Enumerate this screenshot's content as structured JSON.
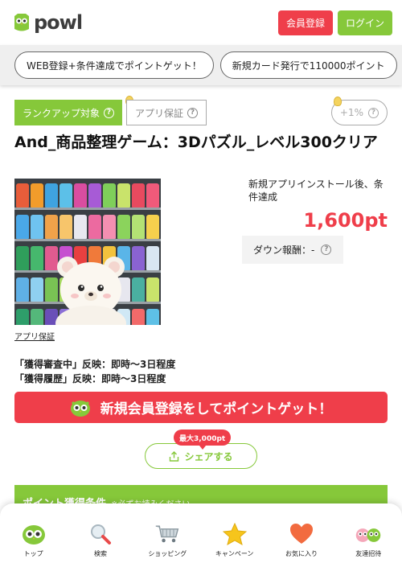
{
  "header": {
    "logo_text": "powl",
    "register_label": "会員登録",
    "login_label": "ログイン"
  },
  "banners": [
    {
      "label": "WEB登録+条件達成でポイントゲット！"
    },
    {
      "label": "新規カード発行で110000ポイント"
    }
  ],
  "tags": {
    "rank_up": "ランクアップ対象",
    "app_guarantee": "アプリ保証",
    "plus_rate": "+1%"
  },
  "offer": {
    "title": "And_商品整理ゲーム：3Dパズル_レベル300クリア",
    "condition": "新規アプリインストール後、条件達成",
    "points": "1,600pt",
    "down_reward": "ダウン報酬：-",
    "app_guarantee_link": "アプリ保証",
    "status_pending": "「獲得審査中」反映：即時〜3日程度",
    "status_history": "「獲得履歴」反映：即時〜3日程度"
  },
  "cta": {
    "label": "新規会員登録をしてポイントゲット！"
  },
  "share": {
    "max_badge": "最大3,000pt",
    "label": "シェアする"
  },
  "conditions": {
    "heading": "ポイント獲得条件",
    "note": "※必ずお読みください"
  },
  "bottom_nav": [
    {
      "label": "トップ"
    },
    {
      "label": "検索"
    },
    {
      "label": "ショッピング"
    },
    {
      "label": "キャンペーン"
    },
    {
      "label": "お気に入り"
    },
    {
      "label": "友達招待"
    }
  ],
  "colors": {
    "brand_green": "#86c83a",
    "brand_red": "#ef3e4a"
  }
}
